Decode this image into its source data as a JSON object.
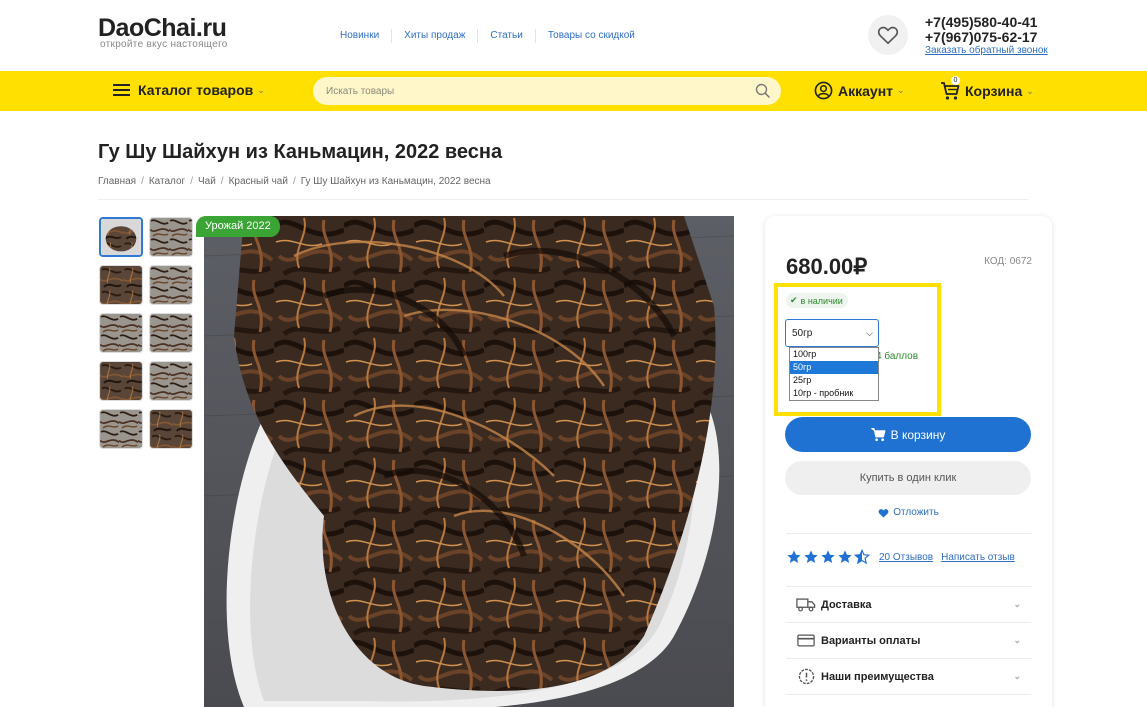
{
  "header": {
    "logo": "DaoChai.ru",
    "tagline": "откройте вкус настоящего",
    "nav": [
      "Новинки",
      "Хиты продаж",
      "Статьи",
      "Товары со скидкой"
    ],
    "phones": [
      "+7(495)580-40-41",
      "+7(967)075-62-17"
    ],
    "callback": "Заказать обратный звонок"
  },
  "toolbar": {
    "catalog_label": "Каталог товаров",
    "search_placeholder": "Искать товары",
    "account_label": "Аккаунт",
    "cart_label": "Корзина",
    "cart_count": "0"
  },
  "product": {
    "title": "Гу Шу Шайхун из Каньмацин, 2022 весна",
    "breadcrumbs": [
      "Главная",
      "Каталог",
      "Чай",
      "Красный чай",
      "Гу Шу Шайхун из Каньмацин, 2022 весна"
    ],
    "badge": "Урожай 2022",
    "price": "680.00",
    "currency": "₽",
    "code": "КОД: 0672",
    "stock": "в наличии",
    "selected_weight": "50гр",
    "weight_options": [
      "100гр",
      "50гр",
      "25гр",
      "10гр - пробник"
    ],
    "points_text": "4 баллов",
    "add_to_cart": "В корзину",
    "buy_one_click": "Купить в один клик",
    "postpone": "Отложить",
    "rating": 4.5,
    "reviews_link": "20 Отзывов",
    "write_review": "Написать отзыв",
    "accordion": [
      "Доставка",
      "Варианты оплаты",
      "Наши преимущества"
    ]
  },
  "colors": {
    "accent_yellow": "#ffe000",
    "primary_blue": "#1f72d2",
    "stock_green": "#2d8a2d",
    "badge_green": "#3aa535"
  },
  "icons": [
    "heart-icon",
    "burger-icon",
    "search-icon",
    "account-icon",
    "cart-icon",
    "check-icon",
    "star-icon",
    "truck-icon",
    "card-icon",
    "info-icon",
    "chevron-down-icon"
  ]
}
